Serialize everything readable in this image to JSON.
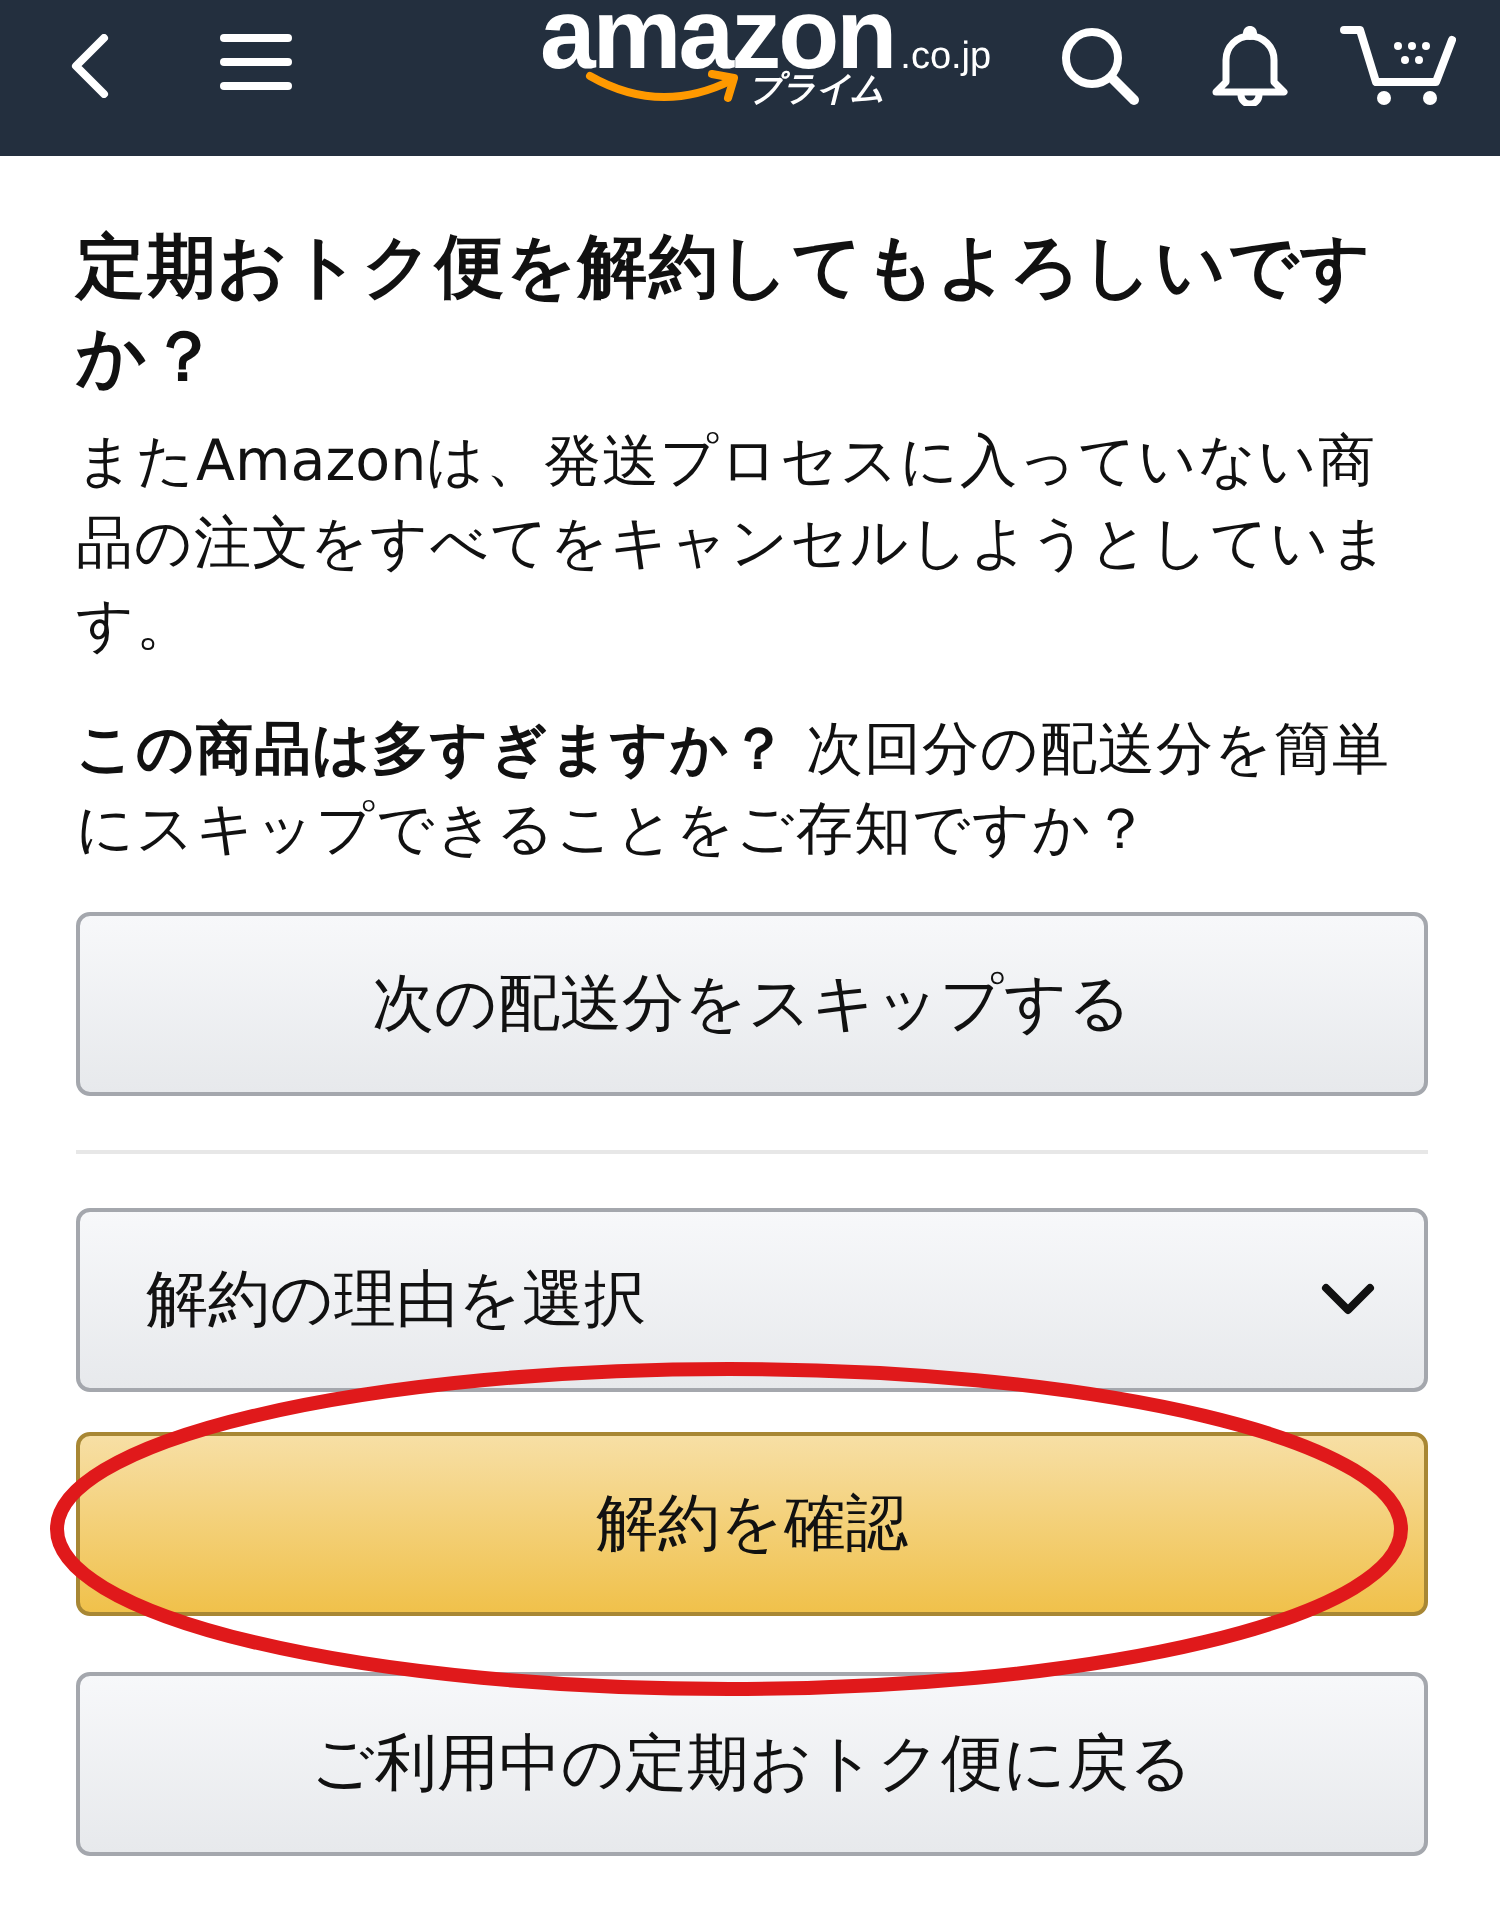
{
  "header": {
    "logo": {
      "wordmark": "amazon",
      "domain": ".co.jp",
      "program": "プライム"
    }
  },
  "title": "定期おトク便を解約してもよろしいですか？",
  "notice": "またAmazonは、発送プロセスに入っていない商品の注文をすべてをキャンセルしようとしています。",
  "skip_offer": {
    "text": "**この商品は多すぎますか？** 次回分の配送分を簡単にスキップできることをご存知ですか？",
    "button": {
      "kind": "secondary",
      "label": "次の配送分をスキップする",
      "circled": false
    }
  },
  "cancel_form": {
    "reason_select": {
      "placeholder": "解約の理由を選択"
    },
    "buttons": [
      {
        "kind": "primary",
        "label": "解約を確認",
        "circled": true
      },
      {
        "kind": "secondary",
        "label": "ご利用中の定期おトク便に戻る",
        "circled": false
      }
    ]
  }
}
